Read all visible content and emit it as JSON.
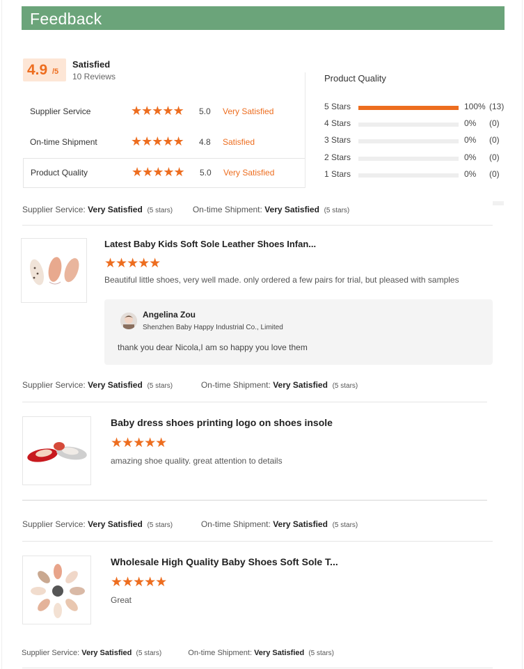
{
  "header": {
    "title": "Feedback"
  },
  "summary": {
    "score": "4.9",
    "score_out_of": "/5",
    "label": "Satisfied",
    "review_count": "10 Reviews",
    "ratings": [
      {
        "label": "Supplier Service",
        "stars": "★★★★★",
        "value": "5.0",
        "verdict": "Very Satisfied"
      },
      {
        "label": "On-time Shipment",
        "stars": "★★★★★",
        "value": "4.8",
        "verdict": "Satisfied"
      },
      {
        "label": "Product Quality",
        "stars": "★★★★★",
        "value": "5.0",
        "verdict": "Very Satisfied"
      }
    ]
  },
  "product_quality": {
    "title": "Product Quality",
    "rows": [
      {
        "label": "5 Stars",
        "fraction": 1.0,
        "percent": "100%",
        "count": "(13)"
      },
      {
        "label": "4 Stars",
        "fraction": 0,
        "percent": "0%",
        "count": "(0)"
      },
      {
        "label": "3 Stars",
        "fraction": 0,
        "percent": "0%",
        "count": "(0)"
      },
      {
        "label": "2 Stars",
        "fraction": 0,
        "percent": "0%",
        "count": "(0)"
      },
      {
        "label": "1 Stars",
        "fraction": 0,
        "percent": "0%",
        "count": "(0)"
      }
    ]
  },
  "meta": {
    "supplier_label": "Supplier Service:",
    "shipment_label": "On-time Shipment:",
    "verdict": "Very Satisfied",
    "stars_note": "(5 stars)"
  },
  "reviews": [
    {
      "title": "Latest Baby Kids Soft Sole Leather Shoes Infan...",
      "stars": "★★★★★",
      "text": "Beautiful little shoes, very well made. only ordered a few pairs for trial, but pleased with samples",
      "reply": {
        "name": "Angelina Zou",
        "company": "Shenzhen Baby Happy Industrial Co., Limited",
        "text": "thank you dear Nicola,I am so happy you love them"
      }
    },
    {
      "title": "Baby dress shoes printing logo on shoes insole",
      "stars": "★★★★★",
      "text": "amazing shoe quality. great attention to details"
    },
    {
      "title": "Wholesale High Quality Baby Shoes Soft Sole T...",
      "stars": "★★★★★",
      "text": "Great"
    }
  ],
  "colors": {
    "header_green": "#6ba47a",
    "accent_orange": "#ed6d1f"
  }
}
